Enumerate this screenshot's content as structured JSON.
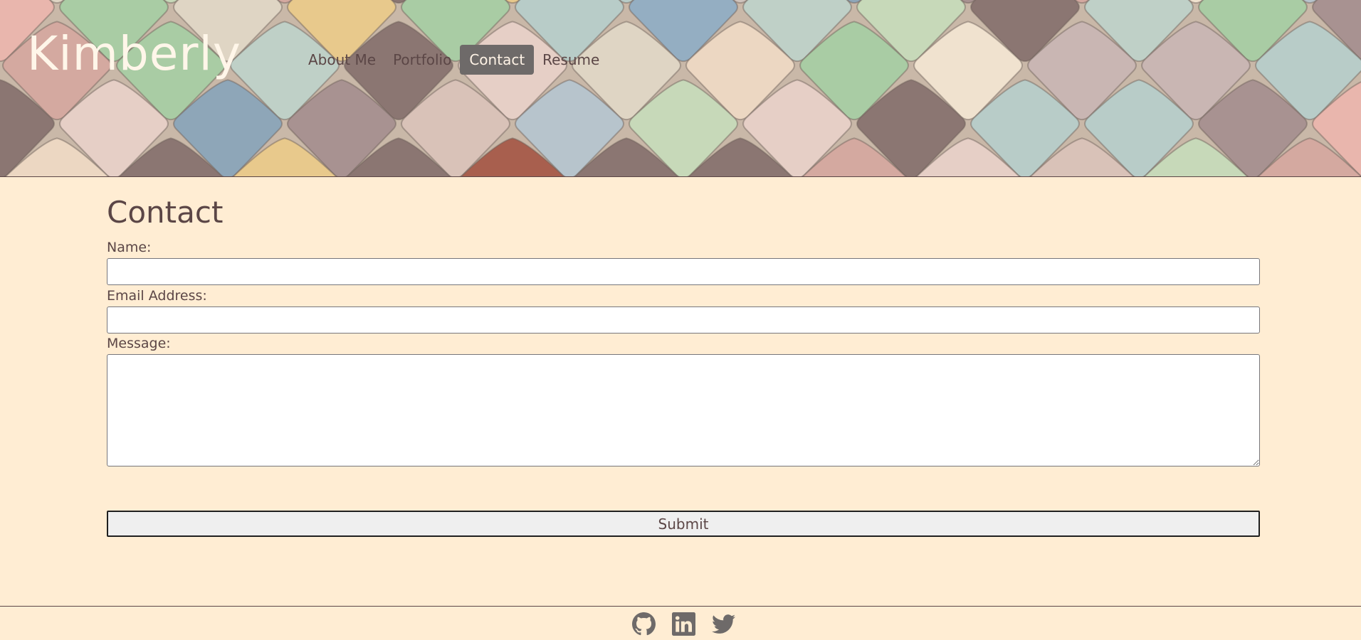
{
  "header": {
    "site_title": "Kimberly",
    "nav": [
      {
        "label": "About Me",
        "active": false
      },
      {
        "label": "Portfolio",
        "active": false
      },
      {
        "label": "Contact",
        "active": true
      },
      {
        "label": "Resume",
        "active": false
      }
    ],
    "background": "colorful-scale-tiles-image"
  },
  "main": {
    "heading": "Contact",
    "form": {
      "name_label": "Name:",
      "name_value": "",
      "email_label": "Email Address:",
      "email_value": "",
      "message_label": "Message:",
      "message_value": "",
      "submit_label": "Submit"
    }
  },
  "footer": {
    "social": [
      {
        "icon": "github-icon"
      },
      {
        "icon": "linkedin-icon"
      },
      {
        "icon": "twitter-icon"
      }
    ]
  },
  "colors": {
    "page_background": "#ffedd3",
    "text": "#5b4646",
    "nav_active_background": "#6e6a69",
    "icon": "#6e6a69"
  }
}
